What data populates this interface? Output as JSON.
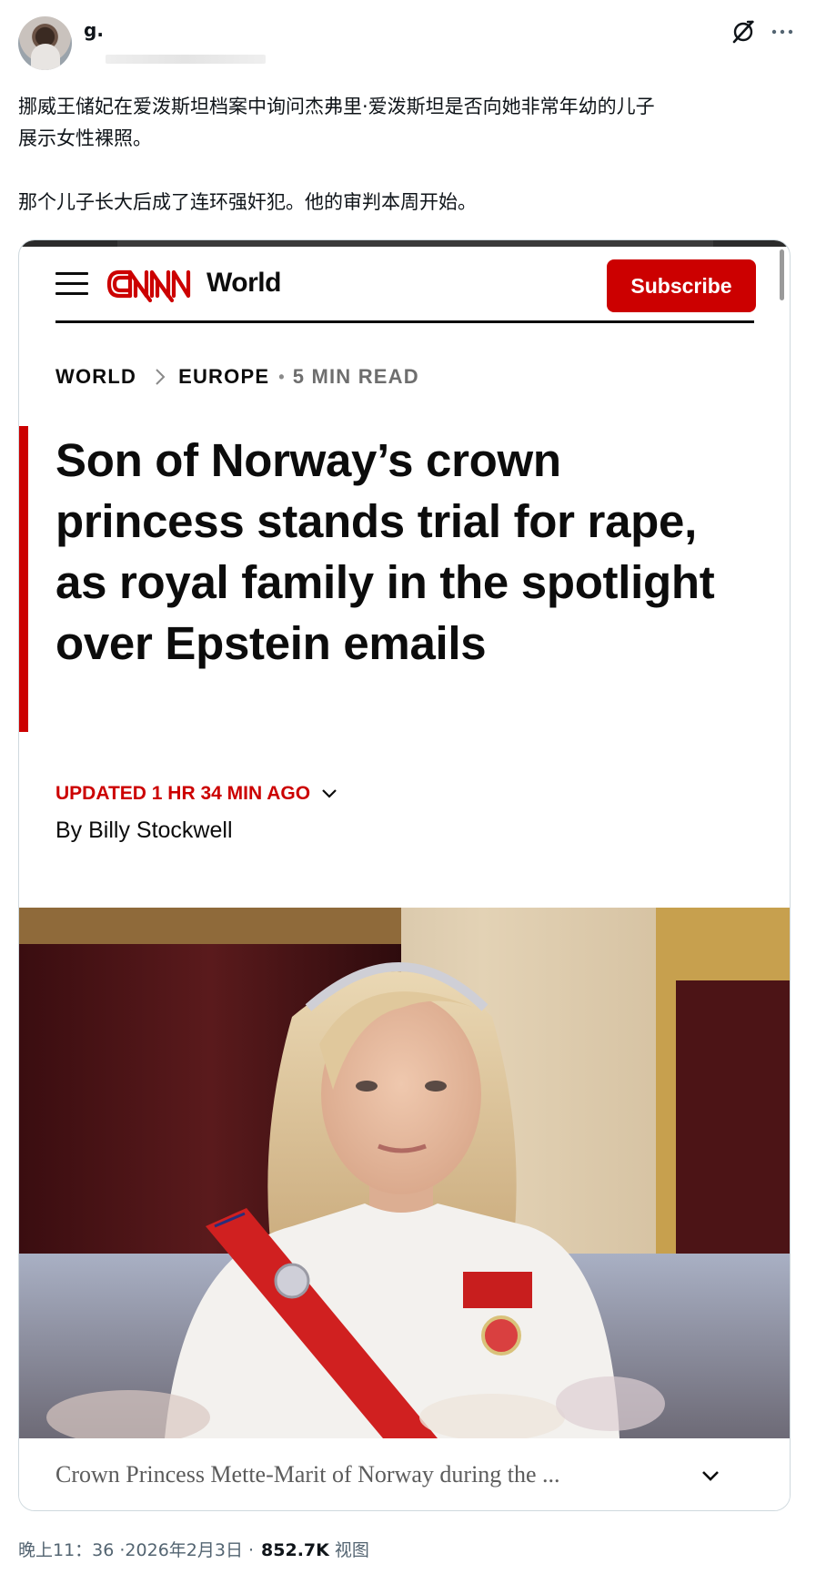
{
  "tweet": {
    "author_name": "g.",
    "text_lines": [
      "挪威王储妃在爱泼斯坦档案中询问杰弗里·爱泼斯坦是否向她非常年幼的儿子",
      "展示女性裸照。",
      "那个儿子长大后成了连环强奸犯。他的审判本周开始。"
    ],
    "timestamp": "晚上11：36 ·2026年2月3日 ·",
    "views_count": "852.7K",
    "views_label": "视图",
    "icons": {
      "grok": "grok-icon",
      "more": "more-icon"
    }
  },
  "article": {
    "section": "World",
    "subscribe_label": "Subscribe",
    "breadcrumb": {
      "level1": "WORLD",
      "level2": "EUROPE",
      "read_time": "5 MIN READ"
    },
    "headline": "Son of Norway’s crown princess stands trial for rape, as royal family in the spotlight over Epstein emails",
    "updated": "UPDATED 1 HR 34 MIN AGO",
    "byline": "By Billy Stockwell",
    "caption": "Crown Princess Mette-Marit of Norway during the ...",
    "colors": {
      "brand_red": "#cc0000",
      "text_dark": "#0c0c0c",
      "caption_gray": "#5c5c5c"
    }
  }
}
